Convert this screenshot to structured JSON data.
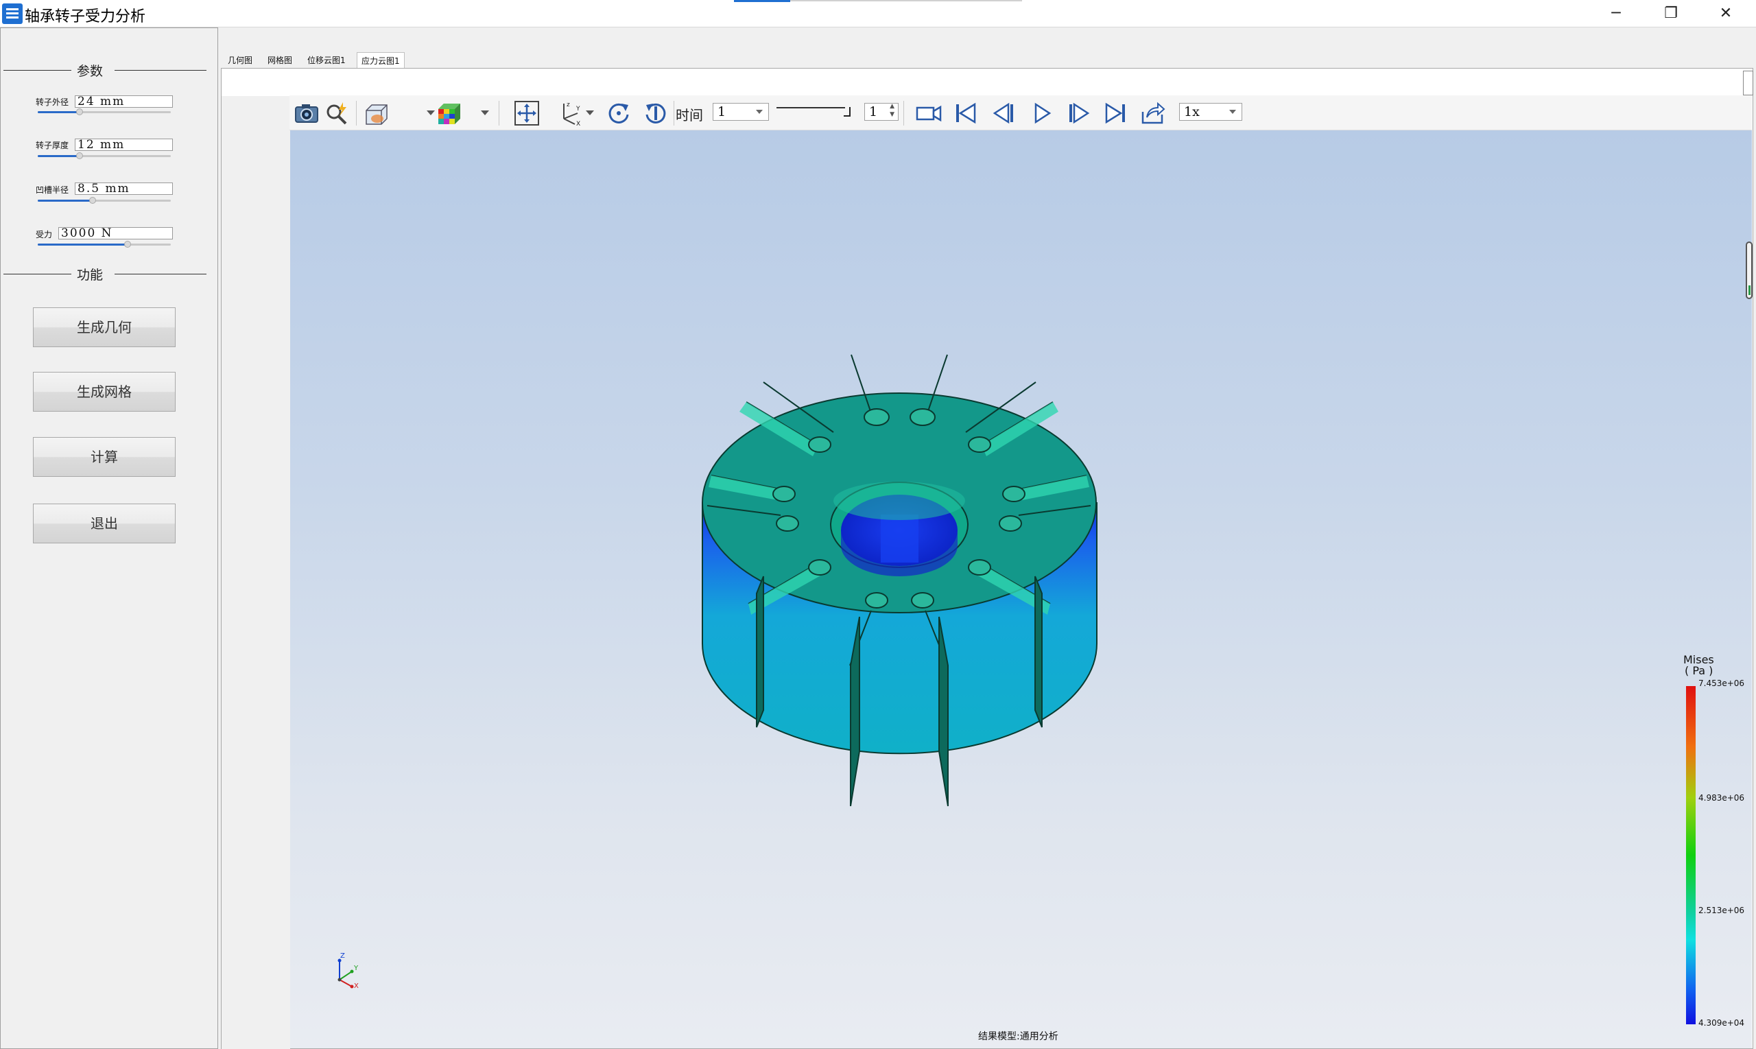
{
  "window": {
    "title": "轴承转子受力分析",
    "controls": {
      "minimize": "─",
      "restore": "❐",
      "close": "✕"
    }
  },
  "params_panel": {
    "group_title": "参数",
    "fields": [
      {
        "label": "转子外径",
        "value": "24 mm",
        "slider_fraction": 0.3
      },
      {
        "label": "转子厚度",
        "value": "12 mm",
        "slider_fraction": 0.3
      },
      {
        "label": "凹槽半径",
        "value": "8.5 mm",
        "slider_fraction": 0.4
      },
      {
        "label": "受力",
        "value": "3000 N",
        "slider_fraction": 0.68
      }
    ]
  },
  "function_panel": {
    "group_title": "功能",
    "buttons": [
      "生成几何",
      "生成网格",
      "计算",
      "退出"
    ]
  },
  "tabs": [
    "几何图",
    "网格图",
    "位移云图1",
    "应力云图1"
  ],
  "active_tab": "应力云图1",
  "toolbar": {
    "time_label": "时间",
    "time_value": "1",
    "frame_value": "1",
    "speed_value": "1x",
    "icons": [
      "camera-icon",
      "probe-icon",
      "display-mode-icon",
      "color-cube-icon",
      "fit-view-icon",
      "axes-icon",
      "rotate-cw-icon",
      "rotate-ccw-icon",
      "record-video-icon",
      "first-frame-icon",
      "prev-frame-icon",
      "play-icon",
      "next-frame-icon",
      "last-frame-icon",
      "export-icon"
    ]
  },
  "legend": {
    "title": "Mises",
    "unit": "( Pa )",
    "ticks": [
      "7.453e+06",
      "4.983e+06",
      "2.513e+06",
      "4.309e+04"
    ]
  },
  "triad_labels": {
    "z": "Z",
    "y": "Y",
    "x": "X"
  },
  "result_model_label": "结果模型:通用分析"
}
